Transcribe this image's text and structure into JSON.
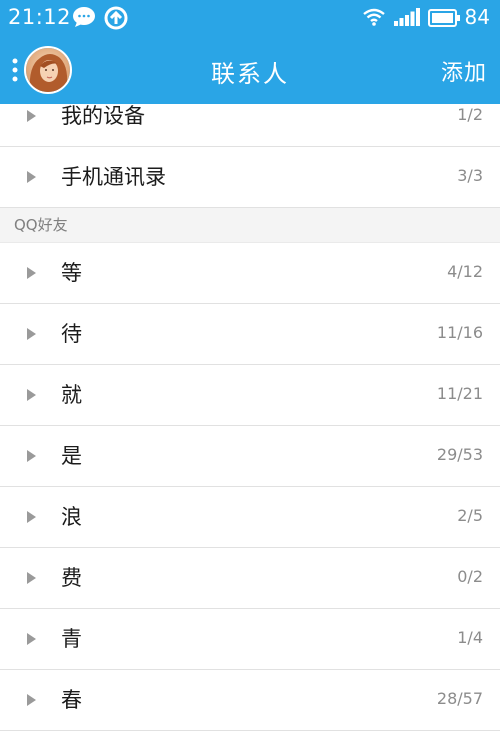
{
  "status_bar": {
    "time": "21:12",
    "battery": "84",
    "icons": [
      "chat-bubble-icon",
      "sync-icon",
      "wifi-icon",
      "signal-icon",
      "battery-icon"
    ]
  },
  "header": {
    "title": "联系人",
    "add_label": "添加",
    "menu_icon": "more-vertical-icon",
    "avatar": "avatar"
  },
  "colors": {
    "header_bg": "#2aa5e6",
    "divider": "#e1e1e1",
    "section_bg": "#f4f4f4"
  },
  "special_groups": [
    {
      "label": "我的设备",
      "count": "1/2"
    },
    {
      "label": "手机通讯录",
      "count": "3/3"
    }
  ],
  "section_title": "QQ好友",
  "friend_groups": [
    {
      "label": "等",
      "count": "4/12"
    },
    {
      "label": "待",
      "count": "11/16"
    },
    {
      "label": "就",
      "count": "11/21"
    },
    {
      "label": "是",
      "count": "29/53"
    },
    {
      "label": "浪",
      "count": "2/5"
    },
    {
      "label": "费",
      "count": "0/2"
    },
    {
      "label": "青",
      "count": "1/4"
    },
    {
      "label": "春",
      "count": "28/57"
    }
  ]
}
